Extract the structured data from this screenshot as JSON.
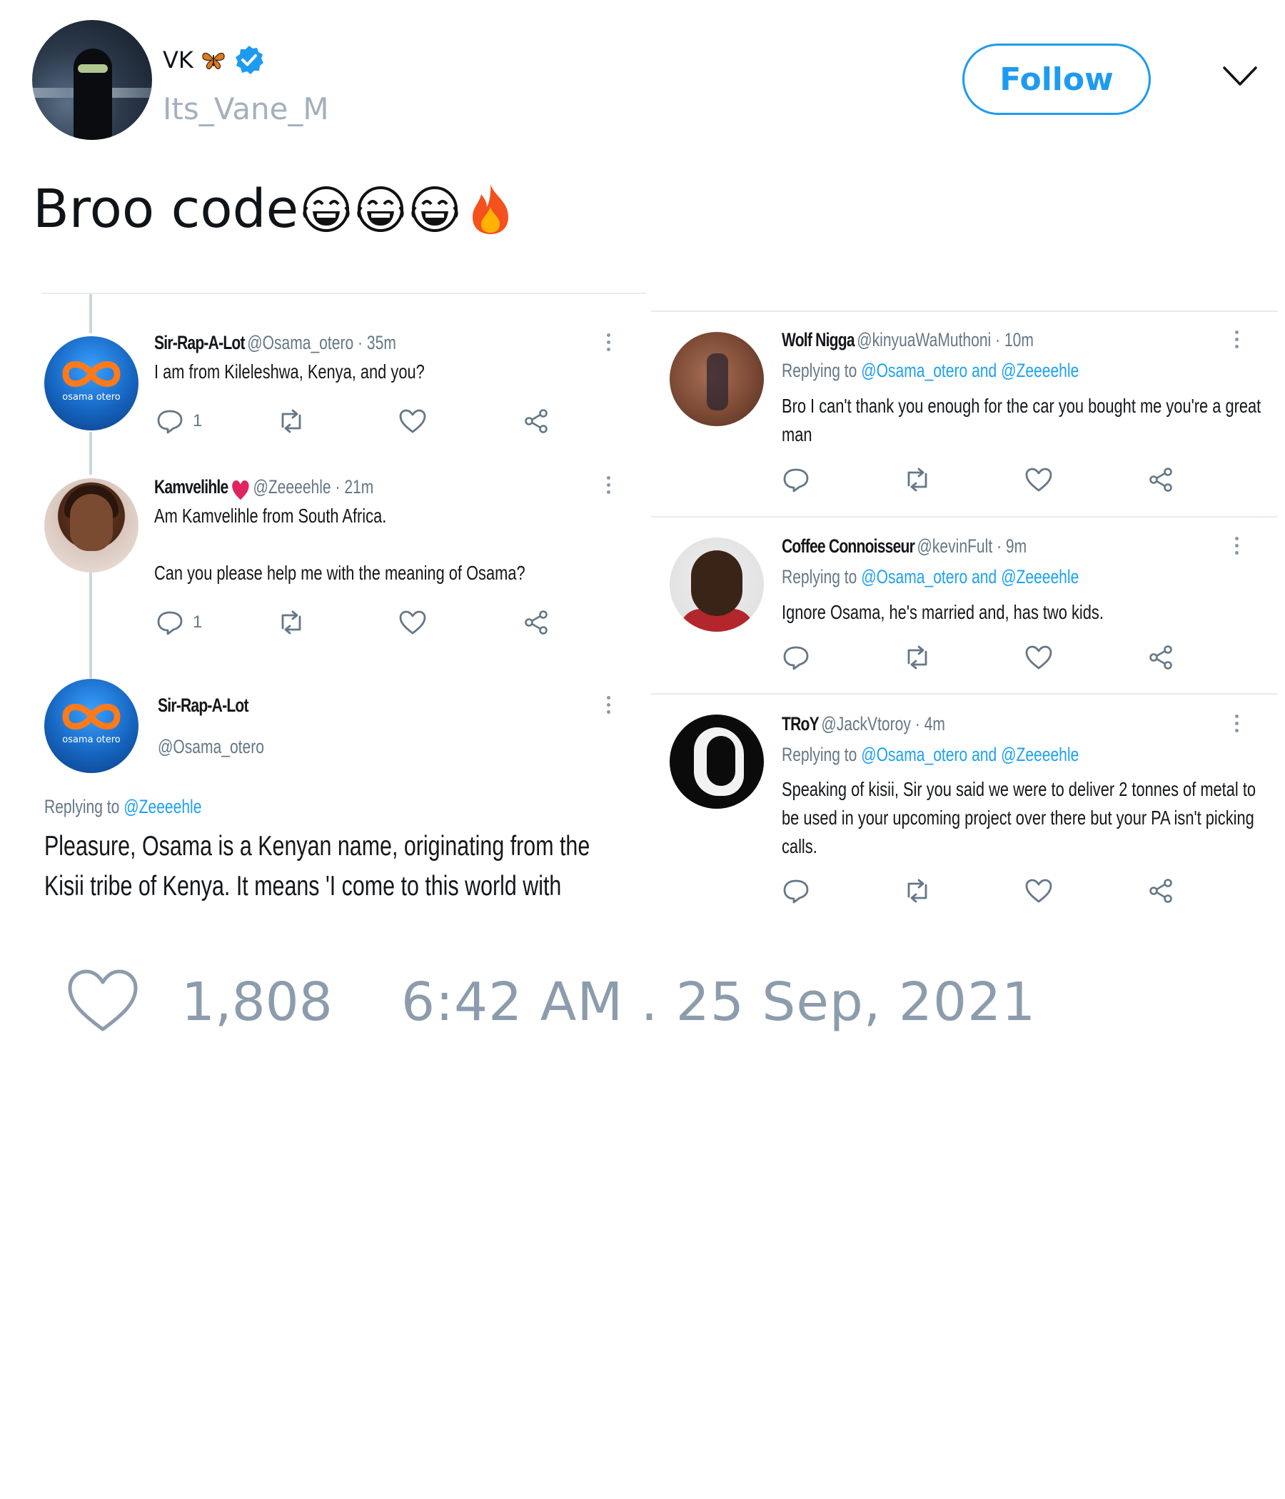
{
  "author": {
    "display_name": "VK",
    "handle": "Its_Vane_M"
  },
  "follow_label": "Follow",
  "tweet": {
    "text": "Broo code"
  },
  "embedded": {
    "left": {
      "reply1": {
        "name": "Sir-Rap-A-Lot",
        "meta": "@Osama_otero · 35m",
        "text": "I am from Kileleshwa, Kenya, and you?",
        "reply_count": "1"
      },
      "reply2": {
        "name": "Kamvelihle",
        "meta": "@Zeeeehle · 21m",
        "text1": "Am Kamvelihle from South Africa.",
        "text2": "Can you please help me with the meaning of Osama?",
        "reply_count": "1"
      },
      "main": {
        "name": "Sir-Rap-A-Lot",
        "handle": "@Osama_otero",
        "replying_prefix": "Replying to",
        "replying_to": "@Zeeeehle",
        "text1": "Pleasure, Osama is a Kenyan name, originating from the",
        "text2": "Kisii tribe of Kenya. It means 'I come to this world with"
      },
      "logo_text": "osama otero"
    },
    "right": {
      "replying_prefix": "Replying to",
      "replying_to_1": "@Osama_otero",
      "replying_and": "and",
      "replying_to_2": "@Zeeeehle",
      "r1": {
        "name": "Wolf Nigga",
        "meta": "@kinyuaWaMuthoni · 10m",
        "text1": "Bro I can't thank you enough for the car you bought me you're a great",
        "text2": "man"
      },
      "r2": {
        "name": "Coffee Connoisseur",
        "meta": "@kevinFult · 9m",
        "text1": "Ignore Osama, he's married and, has two kids."
      },
      "r3": {
        "name": "TRoY",
        "meta": "@JackVtoroy · 4m",
        "text1": "Speaking of kisii, Sir you said we were to deliver 2 tonnes of metal to",
        "text2": "be used in your upcoming project over there but your PA isn't picking",
        "text3": "calls."
      }
    }
  },
  "stats": {
    "likes": "1,808",
    "timestamp": "6:42 AM . 25 Sep, 2021"
  },
  "colors": {
    "accent": "#1d9bf0",
    "muted": "#8c9cad",
    "link": "#1da1f2"
  },
  "icons": [
    "butterfly-icon",
    "verified-icon",
    "chevron-down-icon",
    "laugh-cry-emoji",
    "fire-emoji",
    "reply-icon",
    "retweet-icon",
    "like-icon",
    "share-icon",
    "more-icon"
  ]
}
